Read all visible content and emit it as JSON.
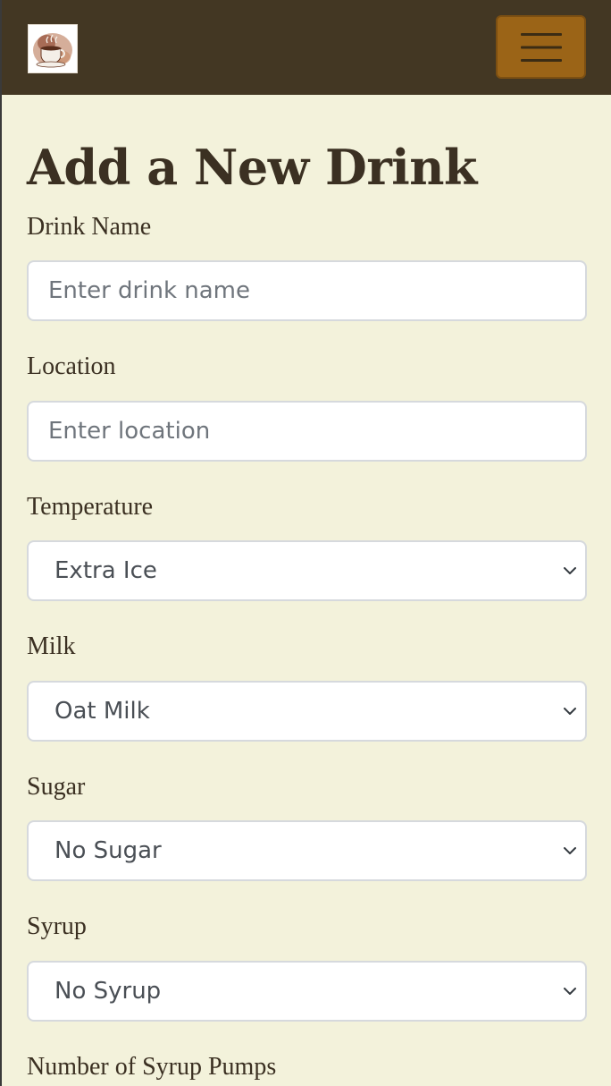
{
  "navbar": {
    "logo_icon": "coffee-cup-logo",
    "menu_icon": "hamburger-menu-icon",
    "bg_color": "#433723",
    "toggle_color": "#9b6417"
  },
  "page": {
    "title": "Add a New Drink",
    "bg_color": "#f3f2db"
  },
  "form": {
    "drink_name": {
      "label": "Drink Name",
      "placeholder": "Enter drink name",
      "value": ""
    },
    "location": {
      "label": "Location",
      "placeholder": "Enter location",
      "value": ""
    },
    "temperature": {
      "label": "Temperature",
      "selected": "Extra Ice"
    },
    "milk": {
      "label": "Milk",
      "selected": "Oat Milk"
    },
    "sugar": {
      "label": "Sugar",
      "selected": "No Sugar"
    },
    "syrup": {
      "label": "Syrup",
      "selected": "No Syrup"
    },
    "syrup_pumps": {
      "label": "Number of Syrup Pumps"
    }
  }
}
